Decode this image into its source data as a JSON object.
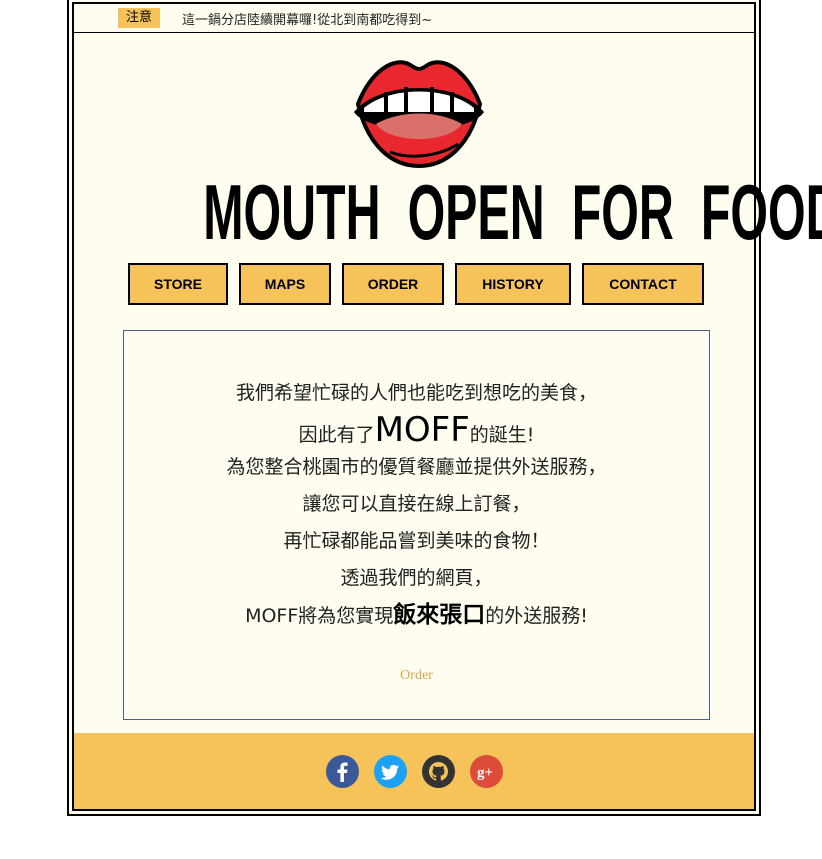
{
  "notice": {
    "badge": "注意",
    "text": "這一鍋分店陸續開幕囉!從北到南都吃得到~"
  },
  "logo": {
    "title": "MOUTH OPEN FOR FOOD"
  },
  "nav": {
    "items": [
      {
        "label": "STORE"
      },
      {
        "label": "MAPS"
      },
      {
        "label": "ORDER"
      },
      {
        "label": "HISTORY"
      },
      {
        "label": "CONTACT"
      }
    ]
  },
  "content": {
    "line1": "我們希望忙碌的人們也能吃到想吃的美食，",
    "line2_pre": "因此有了",
    "line2_big": "MOFF",
    "line2_post": "的誕生!",
    "line3": "為您整合桃園市的優質餐廳並提供外送服務，",
    "line4": "讓您可以直接在線上訂餐，",
    "line5": "再忙碌都能品嘗到美味的食物！",
    "line6": "透過我們的網頁，",
    "line7_pre": "MOFF將為您實現",
    "line7_big": "飯來張口",
    "line7_post": "的外送服務!",
    "order_link": "Order"
  },
  "footer": {
    "social": [
      {
        "name": "facebook-icon",
        "glyph": "f",
        "color": "#3b5998"
      },
      {
        "name": "twitter-icon",
        "glyph": "t",
        "color": "#1da1f2"
      },
      {
        "name": "github-icon",
        "glyph": "g",
        "color": "#333333"
      },
      {
        "name": "google-plus-icon",
        "glyph": "g+",
        "color": "#dd4b39"
      }
    ]
  },
  "colors": {
    "accent": "#f5c35a",
    "background": "#fffdf0",
    "order_link": "#d9a84c"
  }
}
